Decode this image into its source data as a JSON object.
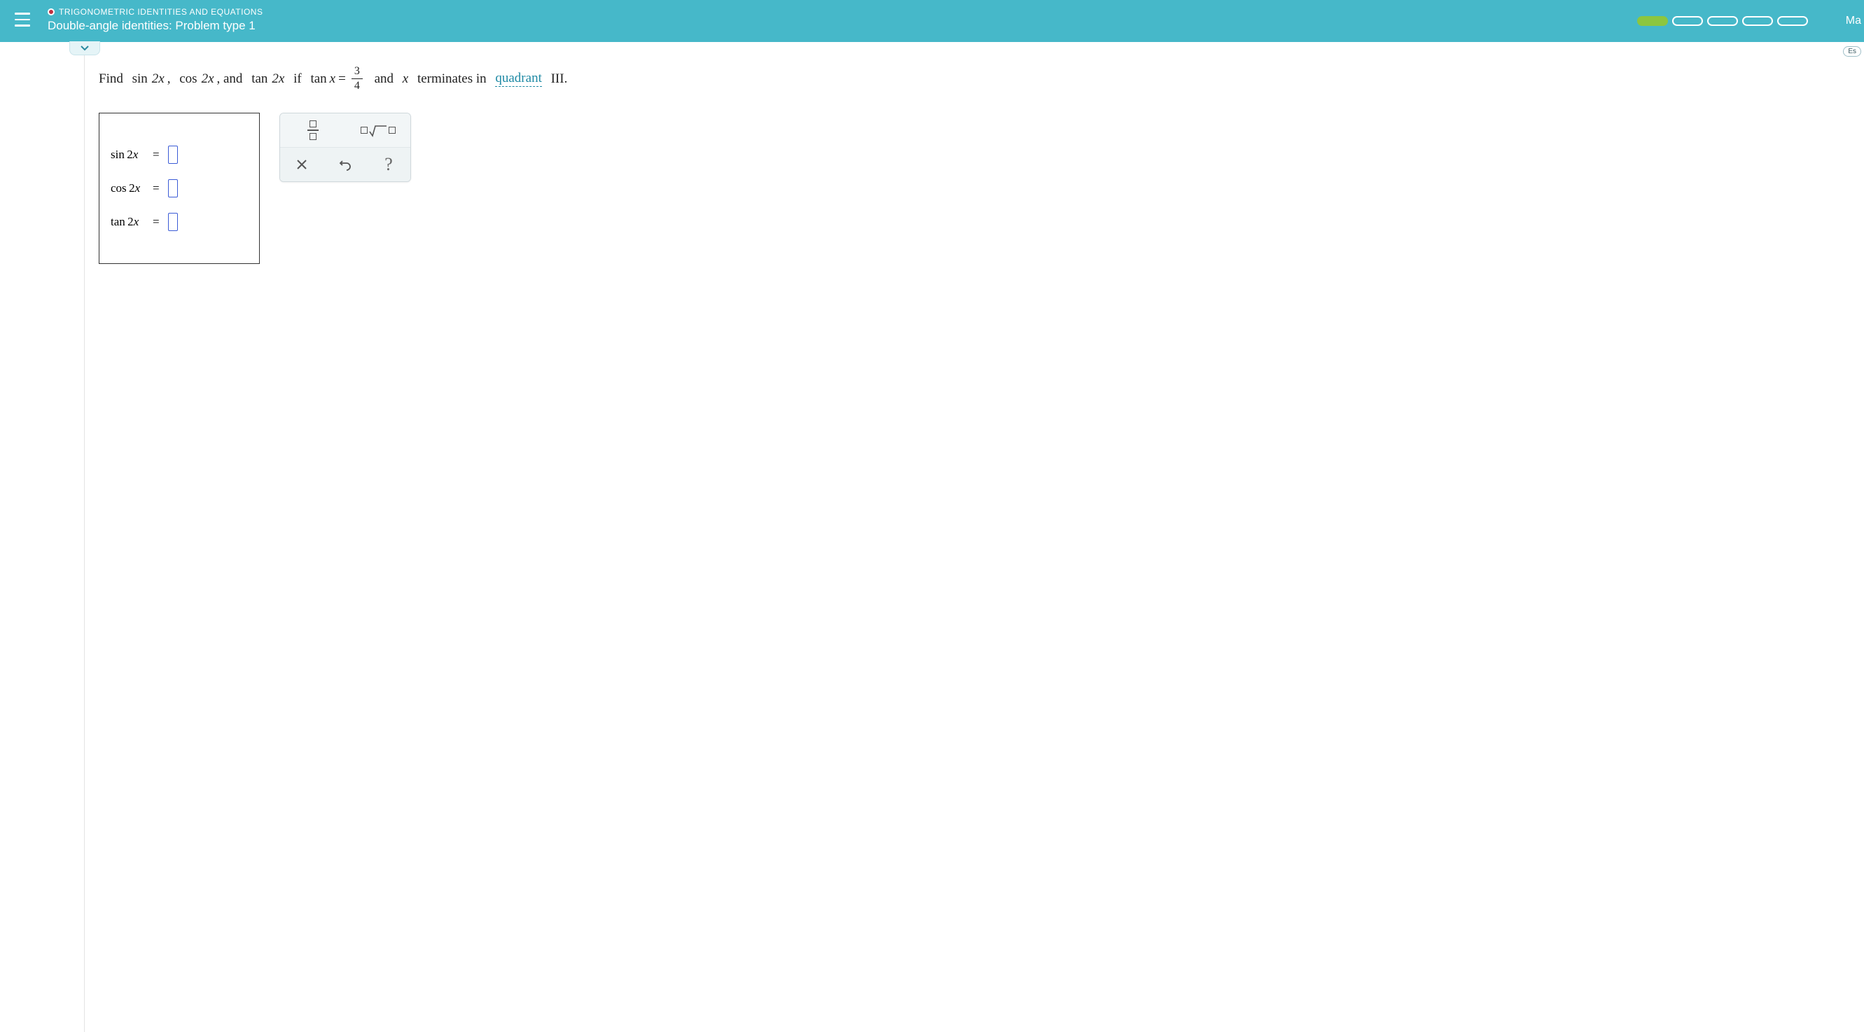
{
  "header": {
    "breadcrumb": "TRIGONOMETRIC IDENTITIES AND EQUATIONS",
    "title": "Double-angle identities: Problem type 1",
    "right_label": "Ma"
  },
  "toolbar_pill": {
    "label": "Es"
  },
  "question": {
    "lead": "Find",
    "t1": "sin",
    "arg1": "2x",
    "sep1": ",",
    "t2": "cos",
    "arg2": "2x",
    "sep2": ", and",
    "t3": "tan",
    "arg3": "2x",
    "if_text": "if",
    "tanx_lhs": "tan",
    "tanx_var": "x",
    "equals": "=",
    "frac_num": "3",
    "frac_den": "4",
    "and_text": "and",
    "x_var": "x",
    "terminates": "terminates in",
    "link": "quadrant",
    "roman": "III."
  },
  "answers": {
    "rows": [
      {
        "func": "sin",
        "arg": "2x"
      },
      {
        "func": "cos",
        "arg": "2x"
      },
      {
        "func": "tan",
        "arg": "2x"
      }
    ],
    "eq": "="
  },
  "tools": {
    "fraction": "fraction",
    "sqrt": "square-root",
    "clear": "clear",
    "undo": "undo",
    "help": "?"
  }
}
